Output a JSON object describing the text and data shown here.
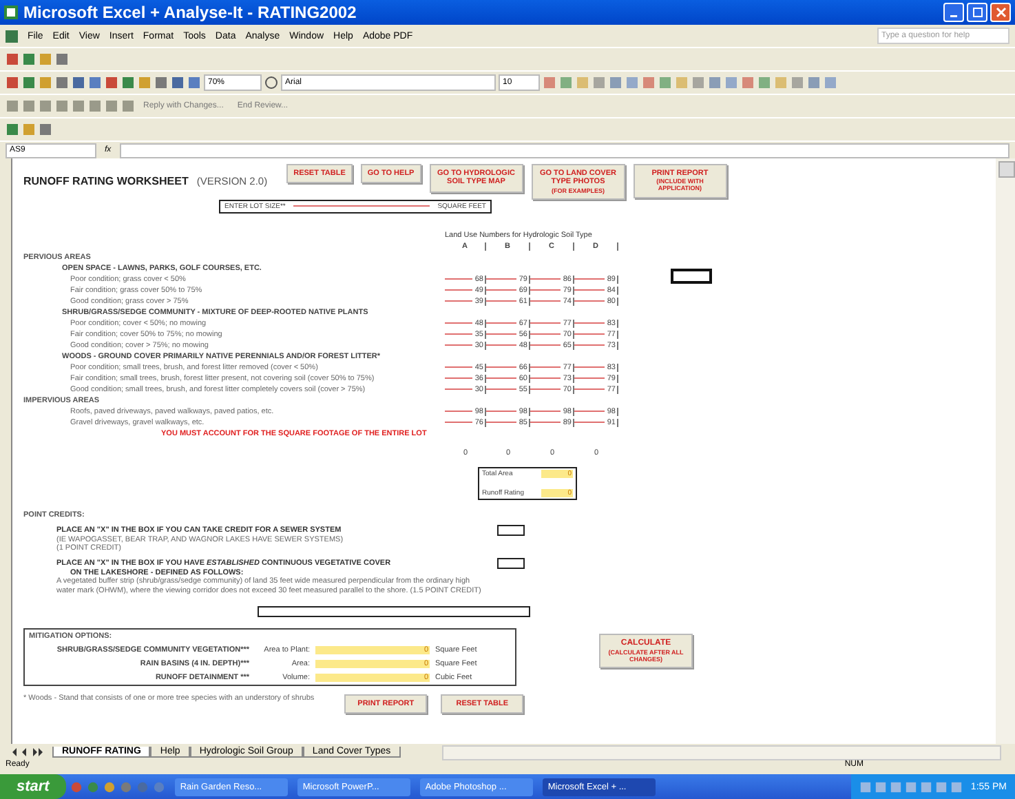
{
  "window": {
    "title": "Microsoft Excel + Analyse-It - RATING2002"
  },
  "menu": [
    "File",
    "Edit",
    "View",
    "Insert",
    "Format",
    "Tools",
    "Data",
    "Analyse",
    "Window",
    "Help",
    "Adobe PDF"
  ],
  "help_box": {
    "placeholder": "Type a question for help"
  },
  "toolbar": {
    "zoom": "70%",
    "font": "Arial",
    "size": "10",
    "review": [
      "Reply with Changes...",
      "End Review..."
    ]
  },
  "formula_bar": {
    "cell": "AS9",
    "fx": "fx"
  },
  "sheet": {
    "title": "RUNOFF RATING WORKSHEET",
    "version": "(VERSION 2.0)",
    "buttons": [
      {
        "label": "RESET TABLE"
      },
      {
        "label": "GO TO HELP"
      },
      {
        "label": "GO TO HYDROLOGIC SOIL TYPE MAP"
      },
      {
        "label": "GO TO LAND COVER TYPE PHOTOS",
        "note": "(FOR EXAMPLES)"
      },
      {
        "label": "PRINT REPORT",
        "note": "(INCLUDE WITH APPLICATION)"
      }
    ],
    "lot_size": {
      "label": "ENTER LOT SIZE**",
      "unit": "SQUARE FEET"
    },
    "land_use": {
      "heading": "Land Use Numbers for Hydrologic Soil Type",
      "columns": [
        "A",
        "B",
        "C",
        "D"
      ],
      "rows": [
        {
          "kind": "section",
          "label": "PERVIOUS AREAS"
        },
        {
          "kind": "group",
          "label": "OPEN SPACE - LAWNS, PARKS, GOLF COURSES, ETC."
        },
        {
          "kind": "item",
          "label": "Poor condition; grass cover < 50%",
          "values": [
            "68",
            "79",
            "86",
            "89"
          ]
        },
        {
          "kind": "item",
          "label": "Fair condition; grass cover 50% to 75%",
          "values": [
            "49",
            "69",
            "79",
            "84"
          ]
        },
        {
          "kind": "item",
          "label": "Good condition; grass cover > 75%",
          "values": [
            "39",
            "61",
            "74",
            "80"
          ]
        },
        {
          "kind": "group",
          "label": "SHRUB/GRASS/SEDGE COMMUNITY - MIXTURE OF DEEP-ROOTED NATIVE PLANTS"
        },
        {
          "kind": "item",
          "label": "Poor condition; cover < 50%; no mowing",
          "values": [
            "48",
            "67",
            "77",
            "83"
          ]
        },
        {
          "kind": "item",
          "label": "Fair condition; cover 50% to 75%; no mowing",
          "values": [
            "35",
            "56",
            "70",
            "77"
          ]
        },
        {
          "kind": "item",
          "label": "Good condition; cover > 75%; no mowing",
          "values": [
            "30",
            "48",
            "65",
            "73"
          ]
        },
        {
          "kind": "group",
          "label": "WOODS - GROUND COVER PRIMARILY NATIVE PERENNIALS AND/OR FOREST LITTER*"
        },
        {
          "kind": "item",
          "label": "Poor condition; small trees, brush, and forest litter removed (cover < 50%)",
          "values": [
            "45",
            "66",
            "77",
            "83"
          ]
        },
        {
          "kind": "item",
          "label": "Fair condition; small trees, brush, forest litter present, not covering soil (cover 50% to 75%)",
          "values": [
            "36",
            "60",
            "73",
            "79"
          ]
        },
        {
          "kind": "item",
          "label": "Good condition; small trees, brush, and forest litter completely covers soil (cover > 75%)",
          "values": [
            "30",
            "55",
            "70",
            "77"
          ]
        },
        {
          "kind": "section",
          "label": "IMPERVIOUS AREAS"
        },
        {
          "kind": "item",
          "label": "Roofs, paved driveways, paved walkways, paved patios, etc.",
          "values": [
            "98",
            "98",
            "98",
            "98"
          ]
        },
        {
          "kind": "item",
          "label": "Gravel driveways, gravel walkways, etc.",
          "values": [
            "76",
            "85",
            "89",
            "91"
          ]
        },
        {
          "kind": "note",
          "label": "YOU MUST ACCOUNT FOR THE SQUARE FOOTAGE OF THE ENTIRE LOT"
        }
      ],
      "totals": [
        "0",
        "0",
        "0",
        "0"
      ]
    },
    "results": [
      {
        "label": "Total Area",
        "value": "0"
      },
      {
        "label": "Runoff Rating",
        "value": "0"
      }
    ],
    "point_credits": {
      "heading": "POINT CREDITS:",
      "items": [
        {
          "title": "PLACE AN \"X\" IN THE BOX IF YOU CAN TAKE CREDIT FOR A SEWER SYSTEM",
          "lines": [
            "(IE WAPOGASSET, BEAR TRAP, AND WAGNOR LAKES HAVE SEWER SYSTEMS)",
            "(1 POINT CREDIT)"
          ]
        },
        {
          "title": "PLACE AN \"X\" IN THE BOX IF YOU HAVE *ESTABLISHED* CONTINUOUS VEGETATIVE COVER",
          "subtitle": "ON THE LAKESHORE  - DEFINED AS FOLLOWS:",
          "text": "A vegetated buffer strip (shrub/grass/sedge community) of land 35 feet wide measured perpendicular from the ordinary high water mark (OHWM), where the viewing corridor does not exceed 30 feet measured parallel to the shore.  (1.5 POINT CREDIT)"
        }
      ]
    },
    "mitigation": {
      "heading": "MITIGATION OPTIONS:",
      "rows": [
        {
          "name": "SHRUB/GRASS/SEDGE COMMUNITY VEGETATION***",
          "field": "Area to Plant:",
          "value": "0",
          "unit": "Square Feet"
        },
        {
          "name": "RAIN BASINS (4 IN. DEPTH)***",
          "field": "Area:",
          "value": "0",
          "unit": "Square Feet"
        },
        {
          "name": "RUNOFF DETAINMENT ***",
          "field": "Volume:",
          "value": "0",
          "unit": "Cubic Feet"
        }
      ]
    },
    "calculate": {
      "label": "CALCULATE",
      "note": "(CALCULATE AFTER ALL CHANGES)"
    },
    "footnote": "* Woods - Stand that consists of one or more tree species with an understory of shrubs",
    "bottom_buttons": [
      "PRINT REPORT",
      "RESET TABLE"
    ]
  },
  "sheet_tabs": [
    {
      "label": "RUNOFF RATING",
      "selected": true
    },
    {
      "label": "Help",
      "selected": false
    },
    {
      "label": "Hydrologic Soil Group",
      "selected": false
    },
    {
      "label": "Land Cover Types",
      "selected": false
    }
  ],
  "status_bar": {
    "left": "Ready",
    "right": "NUM"
  },
  "taskbar": {
    "start": "start",
    "tasks": [
      {
        "label": "Rain Garden Reso...",
        "selected": false
      },
      {
        "label": "Microsoft PowerP...",
        "selected": false
      },
      {
        "label": "Adobe Photoshop ...",
        "selected": false
      },
      {
        "label": "Microsoft Excel + ...",
        "selected": true
      }
    ],
    "clock": "1:55 PM"
  }
}
